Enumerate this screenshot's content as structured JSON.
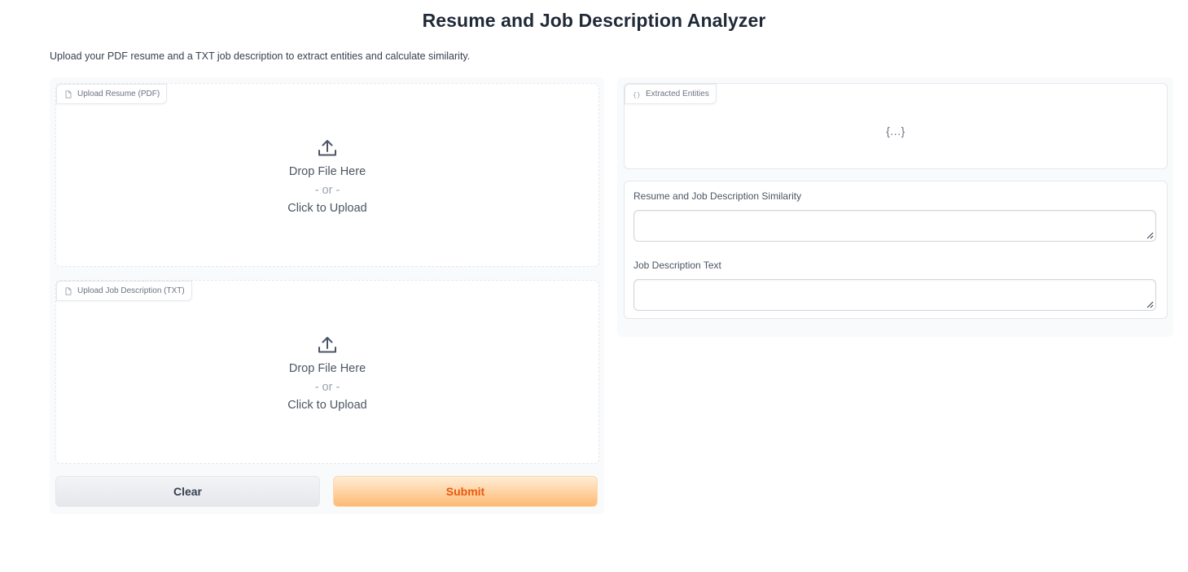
{
  "header": {
    "title": "Resume and Job Description Analyzer",
    "description": "Upload your PDF resume and a TXT job description to extract entities and calculate similarity."
  },
  "inputs": {
    "resume_upload": {
      "label": "Upload Resume (PDF)",
      "drop_text": "Drop File Here",
      "or_text": "- or -",
      "click_text": "Click to Upload"
    },
    "job_upload": {
      "label": "Upload Job Description (TXT)",
      "drop_text": "Drop File Here",
      "or_text": "- or -",
      "click_text": "Click to Upload"
    }
  },
  "buttons": {
    "clear_label": "Clear",
    "submit_label": "Submit"
  },
  "outputs": {
    "entities": {
      "label": "Extracted Entities",
      "placeholder": "{...}"
    },
    "similarity": {
      "label": "Resume and Job Description Similarity",
      "value": ""
    },
    "job_text": {
      "label": "Job Description Text",
      "value": ""
    }
  },
  "colors": {
    "accent": "#ea580c",
    "submit_bg": "#fdba74",
    "panel_bg": "#f9fafb"
  },
  "icons": {
    "file": "file-icon",
    "upload": "upload-icon",
    "json": "json-icon",
    "resize": "resize-grip-icon"
  }
}
